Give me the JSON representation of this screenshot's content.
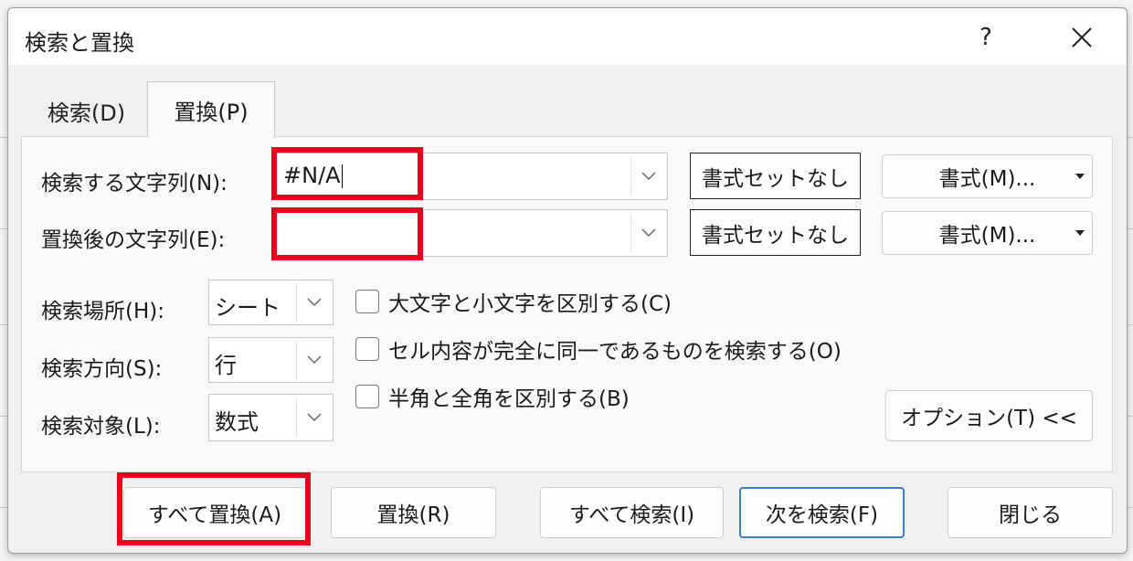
{
  "dialog": {
    "title": "検索と置換",
    "help_label": "?"
  },
  "tabs": [
    {
      "label": "検索(D)"
    },
    {
      "label": "置換(P)"
    }
  ],
  "find": {
    "label": "検索する文字列(N):",
    "value": "#N/A"
  },
  "replace": {
    "label": "置換後の文字列(E):",
    "value": ""
  },
  "format_buttons": {
    "no_format_1": "書式セットなし",
    "no_format_2": "書式セットなし",
    "format_1": "書式(M)...",
    "format_2": "書式(M)..."
  },
  "options": {
    "within_label": "検索場所(H):",
    "within_value": "シート",
    "search_label": "検索方向(S):",
    "search_value": "行",
    "look_in_label": "検索対象(L):",
    "look_in_value": "数式",
    "match_case": "大文字と小文字を区別する(C)",
    "match_entire": "セル内容が完全に同一であるものを検索する(O)",
    "match_byte": "半角と全角を区別する(B)",
    "options_button": "オプション(T) <<"
  },
  "footer": {
    "replace_all": "すべて置換(A)",
    "replace": "置換(R)",
    "find_all": "すべて検索(I)",
    "find_next": "次を検索(F)",
    "close": "閉じる"
  },
  "colors": {
    "highlight": "#e8001c",
    "primary_border": "#3b7dd0"
  }
}
